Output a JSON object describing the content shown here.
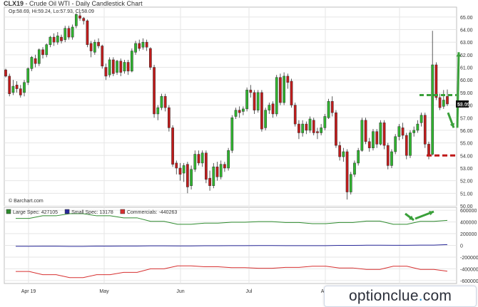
{
  "header": {
    "symbol": "CLX19",
    "title": "Crude Oil WTI - Daily Candlestick Chart",
    "ohlc": "Op:58.69, Hi:59.24, Lo:57.93, Cl:58.09"
  },
  "source": "© Barchart.com",
  "watermark": {
    "a": "optionclue",
    "dot": ".",
    "b": "com"
  },
  "colors": {
    "up": "#2fb52f",
    "down": "#c21b1b",
    "large": "#2e8b2e",
    "small": "#2a2a9a",
    "comm": "#d73030",
    "arrow": "#3aa03a",
    "level": "#c01818",
    "grid": "#e6e6e6"
  },
  "chart_data": [
    {
      "type": "candlestick",
      "title": "Crude Oil WTI - Daily Candlestick Chart",
      "ylim": [
        50,
        65.5
      ],
      "y_ticks": [
        "50.00",
        "51.00",
        "52.00",
        "53.00",
        "54.00",
        "55.00",
        "56.00",
        "57.00",
        "58.00",
        "59.00",
        "60.00",
        "61.00",
        "62.00",
        "63.00",
        "64.00",
        "65.00"
      ],
      "x_ticks": [
        "Apr 19",
        "May",
        "Jun",
        "Jul",
        "Aug",
        "Sep"
      ],
      "last_price": "58.09",
      "levels": {
        "resistance": 58.8,
        "support": 54.0
      },
      "candles": [
        [
          60.8,
          60.3,
          60.9,
          60.2
        ],
        [
          60.3,
          58.9,
          60.5,
          58.7
        ],
        [
          59.0,
          59.5,
          60.0,
          58.8
        ],
        [
          59.6,
          59.3,
          59.9,
          59.0
        ],
        [
          59.3,
          58.8,
          59.6,
          58.6
        ],
        [
          59.0,
          59.8,
          60.0,
          58.7
        ],
        [
          59.8,
          60.9,
          61.0,
          59.6
        ],
        [
          60.9,
          61.8,
          61.9,
          60.7
        ],
        [
          61.7,
          61.3,
          62.0,
          61.0
        ],
        [
          61.3,
          62.4,
          62.5,
          61.1
        ],
        [
          62.4,
          62.0,
          62.6,
          61.7
        ],
        [
          62.0,
          62.8,
          62.9,
          61.8
        ],
        [
          62.8,
          63.4,
          63.5,
          62.6
        ],
        [
          63.4,
          63.0,
          63.7,
          62.7
        ],
        [
          63.0,
          63.5,
          63.8,
          62.8
        ],
        [
          63.4,
          63.1,
          63.6,
          62.9
        ],
        [
          63.2,
          64.1,
          64.3,
          63.0
        ],
        [
          64.1,
          63.4,
          64.3,
          63.2
        ],
        [
          63.4,
          64.2,
          64.4,
          63.2
        ],
        [
          64.3,
          65.2,
          65.3,
          64.1
        ],
        [
          65.1,
          64.9,
          65.4,
          64.7
        ],
        [
          64.9,
          64.7,
          65.0,
          64.4
        ],
        [
          64.7,
          62.8,
          64.8,
          62.6
        ],
        [
          62.9,
          62.3,
          63.1,
          61.8
        ],
        [
          62.2,
          63.0,
          63.2,
          62.0
        ],
        [
          63.0,
          62.7,
          63.3,
          62.5
        ],
        [
          62.7,
          61.1,
          62.8,
          60.9
        ],
        [
          61.0,
          60.3,
          61.3,
          60.0
        ],
        [
          60.4,
          61.6,
          61.8,
          60.2
        ],
        [
          61.6,
          60.5,
          61.8,
          60.3
        ],
        [
          60.6,
          61.5,
          61.6,
          60.4
        ],
        [
          61.5,
          60.6,
          61.7,
          60.3
        ],
        [
          60.7,
          61.4,
          61.6,
          60.5
        ],
        [
          61.4,
          60.7,
          61.6,
          60.4
        ],
        [
          60.7,
          62.3,
          62.5,
          60.6
        ],
        [
          62.2,
          62.9,
          63.1,
          62.0
        ],
        [
          62.9,
          62.5,
          63.2,
          62.3
        ],
        [
          62.6,
          63.0,
          63.3,
          62.4
        ],
        [
          63.0,
          62.6,
          63.2,
          62.3
        ],
        [
          62.5,
          61.0,
          62.6,
          60.8
        ],
        [
          61.0,
          57.3,
          61.2,
          57.0
        ],
        [
          57.3,
          57.8,
          58.0,
          56.8
        ],
        [
          57.8,
          58.7,
          58.9,
          57.6
        ],
        [
          58.7,
          57.8,
          58.9,
          57.5
        ],
        [
          57.8,
          56.2,
          58.0,
          55.9
        ],
        [
          56.2,
          53.3,
          56.4,
          53.1
        ],
        [
          53.4,
          53.0,
          53.6,
          52.5
        ],
        [
          53.0,
          52.5,
          53.4,
          52.0
        ],
        [
          52.6,
          53.2,
          53.4,
          51.9
        ],
        [
          53.3,
          51.5,
          53.5,
          51.0
        ],
        [
          51.6,
          52.9,
          53.2,
          51.3
        ],
        [
          52.9,
          54.1,
          54.4,
          52.7
        ],
        [
          54.1,
          53.4,
          54.4,
          53.2
        ],
        [
          53.4,
          54.2,
          54.4,
          53.1
        ],
        [
          54.2,
          52.1,
          54.4,
          51.8
        ],
        [
          52.2,
          51.6,
          52.8,
          51.2
        ],
        [
          51.6,
          53.1,
          53.4,
          51.4
        ],
        [
          53.1,
          52.3,
          53.5,
          52.0
        ],
        [
          52.3,
          53.3,
          53.6,
          52.1
        ],
        [
          53.3,
          53.0,
          53.5,
          52.7
        ],
        [
          53.0,
          54.4,
          54.6,
          52.8
        ],
        [
          54.4,
          57.0,
          57.2,
          54.2
        ],
        [
          57.1,
          57.6,
          57.8,
          56.9
        ],
        [
          57.6,
          57.4,
          57.9,
          57.0
        ],
        [
          57.5,
          57.7,
          57.9,
          57.2
        ],
        [
          57.7,
          59.2,
          59.4,
          57.5
        ],
        [
          59.2,
          59.0,
          59.6,
          58.6
        ],
        [
          59.0,
          57.6,
          59.2,
          57.3
        ],
        [
          57.6,
          59.0,
          59.2,
          57.4
        ],
        [
          59.0,
          56.1,
          59.2,
          55.9
        ],
        [
          56.2,
          57.6,
          57.8,
          56.0
        ],
        [
          57.6,
          58.0,
          58.2,
          57.3
        ],
        [
          58.1,
          57.3,
          58.3,
          57.0
        ],
        [
          57.3,
          60.2,
          60.4,
          57.1
        ],
        [
          60.2,
          58.2,
          60.5,
          58.0
        ],
        [
          58.2,
          60.3,
          60.6,
          58.0
        ],
        [
          60.3,
          59.8,
          60.5,
          59.3
        ],
        [
          59.9,
          58.0,
          60.1,
          57.8
        ],
        [
          58.0,
          56.5,
          58.2,
          56.3
        ],
        [
          56.5,
          55.8,
          56.8,
          55.3
        ],
        [
          55.8,
          56.5,
          56.8,
          55.5
        ],
        [
          56.5,
          56.0,
          56.7,
          55.7
        ],
        [
          56.0,
          56.9,
          57.1,
          55.8
        ],
        [
          56.8,
          55.8,
          57.0,
          55.6
        ],
        [
          55.9,
          55.8,
          56.2,
          55.3
        ],
        [
          55.8,
          56.2,
          56.5,
          55.6
        ],
        [
          56.2,
          57.1,
          57.3,
          56.0
        ],
        [
          57.0,
          58.3,
          58.5,
          56.9
        ],
        [
          58.3,
          57.4,
          58.7,
          57.1
        ],
        [
          57.4,
          54.8,
          57.6,
          54.6
        ],
        [
          54.8,
          53.9,
          55.1,
          53.6
        ],
        [
          53.9,
          54.3,
          54.6,
          53.5
        ],
        [
          54.3,
          51.1,
          54.5,
          50.5
        ],
        [
          51.1,
          52.5,
          52.7,
          50.9
        ],
        [
          52.5,
          53.4,
          53.6,
          52.3
        ],
        [
          53.4,
          54.4,
          54.6,
          53.2
        ],
        [
          54.4,
          56.8,
          57.0,
          54.3
        ],
        [
          56.8,
          55.1,
          57.0,
          54.9
        ],
        [
          55.1,
          54.6,
          55.4,
          54.3
        ],
        [
          54.6,
          55.9,
          56.1,
          54.4
        ],
        [
          55.9,
          54.9,
          56.1,
          54.6
        ],
        [
          54.9,
          56.6,
          56.8,
          54.8
        ],
        [
          56.6,
          54.8,
          56.8,
          54.5
        ],
        [
          54.8,
          53.2,
          55.0,
          52.9
        ],
        [
          53.2,
          54.3,
          54.5,
          53.0
        ],
        [
          54.3,
          55.5,
          55.7,
          54.1
        ],
        [
          55.5,
          56.3,
          56.5,
          55.2
        ],
        [
          56.2,
          55.6,
          56.6,
          55.3
        ],
        [
          55.6,
          54.0,
          55.8,
          53.7
        ],
        [
          54.0,
          55.8,
          56.0,
          53.8
        ],
        [
          55.8,
          56.0,
          56.3,
          55.5
        ],
        [
          56.0,
          56.5,
          56.8,
          55.8
        ],
        [
          56.6,
          57.2,
          57.4,
          56.3
        ],
        [
          57.2,
          54.9,
          57.4,
          54.6
        ],
        [
          54.9,
          54.0,
          55.1,
          53.7
        ],
        [
          54.1,
          61.2,
          63.9,
          54.0
        ],
        [
          61.2,
          58.6,
          61.4,
          58.4
        ],
        [
          58.6,
          57.8,
          58.9,
          57.6
        ],
        [
          57.9,
          58.4,
          59.2,
          57.7
        ],
        [
          58.69,
          58.09,
          59.24,
          57.93
        ]
      ]
    },
    {
      "type": "line",
      "title": "COT positions",
      "y_ticks": [
        "600000",
        "400000",
        "200000",
        "0",
        "-200000",
        "-400000",
        "-600000"
      ],
      "ylim": [
        -650000,
        650000
      ],
      "series": [
        {
          "name": "Large Spec",
          "label": "Large Spec: 427105",
          "values": [
            460000,
            460000,
            505000,
            505000,
            540000,
            540000,
            505000,
            505000,
            470000,
            470000,
            410000,
            410000,
            360000,
            360000,
            380000,
            380000,
            395000,
            395000,
            405000,
            405000,
            390000,
            390000,
            370000,
            370000,
            390000,
            390000,
            415000,
            415000,
            360000,
            360000,
            410000,
            410000,
            427105
          ]
        },
        {
          "name": "Small Spec",
          "label": "Small Spec: 13178",
          "values": [
            -15000,
            -15000,
            -14000,
            -14000,
            -16000,
            -16000,
            -12000,
            -12000,
            -10000,
            -10000,
            -8000,
            -8000,
            -9000,
            -9000,
            -6000,
            -6000,
            -4000,
            -4000,
            -3000,
            -3000,
            -5000,
            -5000,
            -4000,
            -4000,
            0,
            0,
            3000,
            3000,
            1000,
            1000,
            5000,
            5000,
            13178
          ]
        },
        {
          "name": "Commercials",
          "label": "Commercials: -440263",
          "values": [
            -445000,
            -445000,
            -500000,
            -500000,
            -550000,
            -550000,
            -500000,
            -500000,
            -460000,
            -460000,
            -400000,
            -400000,
            -350000,
            -350000,
            -365000,
            -365000,
            -380000,
            -380000,
            -390000,
            -390000,
            -375000,
            -375000,
            -355000,
            -355000,
            -385000,
            -385000,
            -410000,
            -410000,
            -355000,
            -355000,
            -410000,
            -410000,
            -440263
          ]
        }
      ]
    }
  ]
}
